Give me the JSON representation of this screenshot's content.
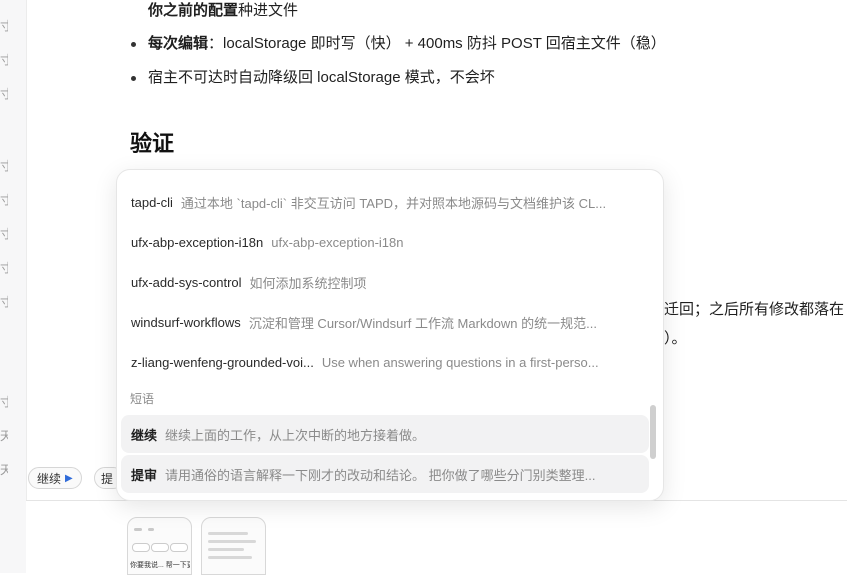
{
  "sidebar": {
    "glyphs": [
      "寸",
      "寸",
      "寸",
      "寸",
      "寸",
      "寸",
      "寸",
      "寸",
      "寸",
      "天",
      "天"
    ]
  },
  "doc": {
    "line1_bold": "你之前的配置",
    "line1_rest": "种进文件",
    "bullet1_bold": "每次编辑",
    "bullet1_rest": "：localStorage 即时写（快） + 400ms 防抖 POST 回宿主文件（稳）",
    "bullet2": "宿主不可达时自动降级回 localStorage 模式，不会坏",
    "heading": "验证",
    "behind_right_1": "迁回；之后所有修改都落在",
    "behind_right_2": "）。"
  },
  "popup": {
    "items": [
      {
        "name": "tapd-cli",
        "desc": "通过本地 `tapd-cli` 非交互访问 TAPD，并对照本地源码与文档维护该 CL..."
      },
      {
        "name": "ufx-abp-exception-i18n",
        "desc": "ufx-abp-exception-i18n"
      },
      {
        "name": "ufx-add-sys-control",
        "desc": "如何添加系统控制项"
      },
      {
        "name": "windsurf-workflows",
        "desc": "沉淀和管理 Cursor/Windsurf 工作流 Markdown 的统一规范..."
      },
      {
        "name": "z-liang-wenfeng-grounded-voi...",
        "desc": "Use when answering questions in a first-perso..."
      }
    ],
    "section_label": "短语",
    "phrases": [
      {
        "name": "继续",
        "desc": "继续上面的工作，从上次中断的地方接着做。"
      },
      {
        "name": "提审",
        "desc": "请用通俗的语言解释一下刚才的改动和结论。 把你做了哪些分门别类整理..."
      }
    ]
  },
  "chips": {
    "continue_label": "继续",
    "continue_arrow": "▶",
    "review_label": "提"
  },
  "thumbs": {
    "t1_text": "你要我说... 帮一下更"
  }
}
